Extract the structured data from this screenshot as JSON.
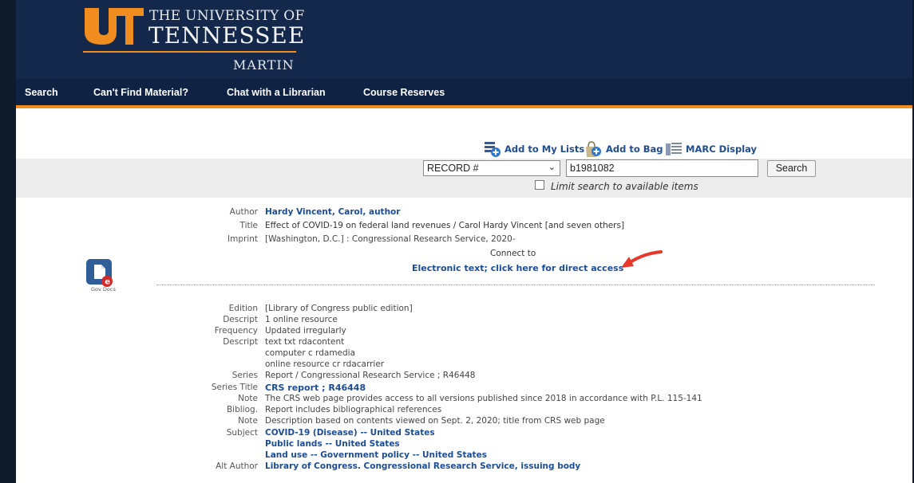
{
  "header": {
    "line1": "THE UNIVERSITY OF",
    "line2": "TENNESSEE",
    "line3": "MARTIN",
    "brand_orange": "#f18d1f",
    "brand_navy": "#14284b"
  },
  "nav": {
    "items": [
      {
        "label": "Search"
      },
      {
        "label": "Can't Find Material?"
      },
      {
        "label": "Chat with a Librarian"
      },
      {
        "label": "Course Reserves"
      }
    ]
  },
  "toolbar": {
    "add_to_lists": "Add to My Lists",
    "add_to_bag": "Add to Bag",
    "marc_display": "MARC Display",
    "icons": [
      "list-add-icon",
      "bag-icon",
      "marc-icon"
    ]
  },
  "search": {
    "field_selected": "RECORD #",
    "query_value": "b1981082",
    "button_label": "Search",
    "limit_label": "Limit search to available items",
    "limit_checked": false
  },
  "record": {
    "gov_doc_caption": "Gov Docs",
    "connect_to": "Connect to",
    "direct_access": "Electronic text; click here for direct access",
    "fields_top": [
      {
        "label": "Author",
        "value": "Hardy Vincent, Carol, author",
        "link": true
      },
      {
        "label": "Title",
        "value": "Effect of COVID-19 on federal land revenues / Carol Hardy Vincent [and seven others]",
        "link": false
      },
      {
        "label": "Imprint",
        "value": "[Washington, D.C.] : Congressional Research Service, 2020-",
        "link": false
      }
    ],
    "fields_bottom": [
      {
        "label": "Edition",
        "values": [
          "[Library of Congress public edition]"
        ],
        "link": false
      },
      {
        "label": "Descript",
        "values": [
          "1 online resource"
        ],
        "link": false
      },
      {
        "label": "Frequency",
        "values": [
          "Updated irregularly"
        ],
        "link": false
      },
      {
        "label": "Descript",
        "values": [
          "text txt rdacontent",
          "computer c rdamedia",
          "online resource cr rdacarrier"
        ],
        "link": false
      },
      {
        "label": "Series",
        "values": [
          "Report / Congressional Research Service ; R46448"
        ],
        "link": false
      },
      {
        "label": "Series Title",
        "values": [
          "CRS report ; R46448"
        ],
        "link": true
      },
      {
        "label": "Note",
        "values": [
          "The CRS web page provides access to all versions published since 2018 in accordance with P.L. 115-141"
        ],
        "link": false
      },
      {
        "label": "Bibliog.",
        "values": [
          "Report includes bibliographical references"
        ],
        "link": false
      },
      {
        "label": "Note",
        "values": [
          "Description based on contents viewed on Sept. 2, 2020; title from CRS web page"
        ],
        "link": false
      },
      {
        "label": "Subject",
        "values": [
          "COVID-19 (Disease) -- United States",
          "Public lands -- United States",
          "Land use -- Government policy -- United States"
        ],
        "link": true
      },
      {
        "label": "Alt Author",
        "values": [
          "Library of Congress. Congressional Research Service, issuing body"
        ],
        "link": true
      }
    ]
  },
  "annotation": {
    "arrow_color": "#e8382b",
    "icon": "red-arrow-icon"
  }
}
